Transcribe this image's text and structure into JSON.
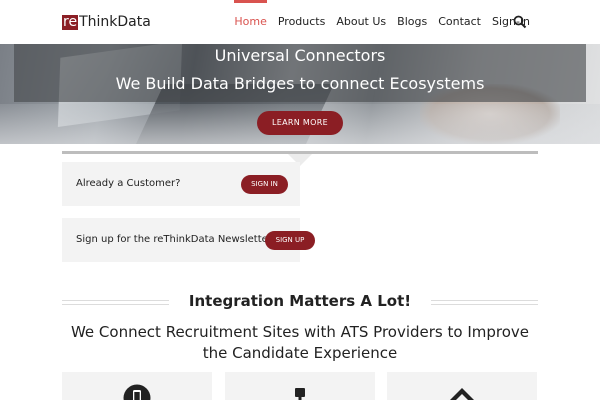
{
  "header": {
    "logo_mark": "re",
    "logo_text": "ThinkData",
    "nav": [
      "Home",
      "Products",
      "About Us",
      "Blogs",
      "Contact",
      "Sign-in"
    ],
    "active_nav": "Home",
    "search_icon": "search-icon"
  },
  "hero": {
    "title": "Universal Connectors",
    "subtitle": "We Build Data Bridges to connect Ecosystems",
    "button": "LEARN MORE"
  },
  "boxes": {
    "customer_label": "Already a Customer?",
    "customer_button": "SIGN IN",
    "newsletter_label": "Sign up for the reThinkData Newsletter",
    "newsletter_button": "SIGN UP"
  },
  "section": {
    "title": "Integration Matters A Lot!",
    "subtitle": "We Connect Recruitment Sites with ATS Providers to Improve the Candidate Experience"
  },
  "cards": {
    "icons": [
      "mobile-icon",
      "plug-icon",
      "diamond-icon"
    ]
  },
  "colors": {
    "brand": "#8b1e24",
    "nav_active": "#d9534f"
  }
}
